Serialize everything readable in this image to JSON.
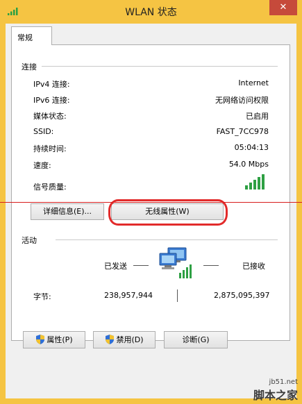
{
  "window": {
    "title": "WLAN 状态",
    "close_label": "✕"
  },
  "tab": {
    "label": "常规"
  },
  "connection": {
    "group_title": "连接",
    "rows": [
      {
        "label": "IPv4 连接:",
        "value": "Internet"
      },
      {
        "label": "IPv6 连接:",
        "value": "无网络访问权限"
      },
      {
        "label": "媒体状态:",
        "value": "已启用"
      },
      {
        "label": "SSID:",
        "value": "FAST_7CC978"
      },
      {
        "label": "持续时间:",
        "value": "05:04:13"
      },
      {
        "label": "速度:",
        "value": "54.0 Mbps"
      },
      {
        "label": "信号质量:",
        "value": ""
      }
    ],
    "details_button": "详细信息(E)...",
    "wireless_button": "无线属性(W)"
  },
  "activity": {
    "group_title": "活动",
    "sent_label": "已发送",
    "received_label": "已接收",
    "bytes_label": "字节:",
    "bytes_sent": "238,957,944",
    "bytes_received": "2,875,095,397"
  },
  "buttons": {
    "properties": "属性(P)",
    "disable": "禁用(D)",
    "diagnose": "诊断(G)"
  },
  "colors": {
    "titlebar": "#f5c443",
    "close": "#c64a3b",
    "signal_green": "#2ea043",
    "annotation_red": "#e22b2b"
  },
  "icons": {
    "title_signal": "wifi-signal-icon",
    "signal_quality": "signal-bars-icon",
    "network": "network-computers-icon",
    "shield": "uac-shield-icon"
  },
  "watermark": {
    "url": "jb51.net",
    "name": "脚本之家"
  }
}
